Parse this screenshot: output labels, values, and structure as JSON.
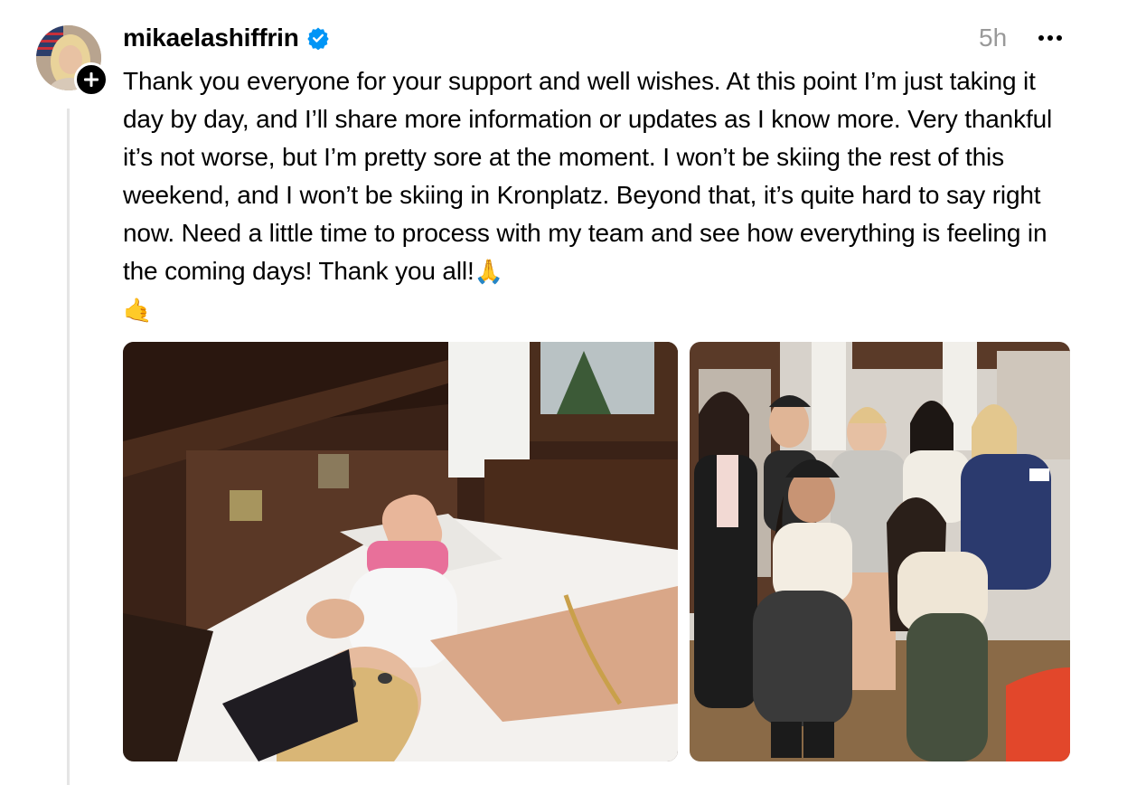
{
  "post": {
    "username": "mikaelashiffrin",
    "verified": true,
    "timestamp": "5h",
    "text_main": "Thank you everyone for your support and well wishes. At this point I’m just taking it day by day, and I’ll share more information or updates as I know more. Very thankful it’s not worse, but I’m pretty sore at the moment. I won’t be skiing the rest of this weekend, and I won’t be skiing in Kronplatz. Beyond that, it’s quite hard to say right now. Need a little time to process with my team and see how everything is feeling in the coming days! Thank you all!",
    "emoji_pray": "🙏",
    "emoji_call": "🤙"
  },
  "icons": {
    "avatar": "profile-photo",
    "follow": "plus-icon",
    "verified": "verified-badge-icon",
    "more": "more-options-icon"
  },
  "colors": {
    "verified_blue": "#0095f6",
    "timestamp_gray": "#999999",
    "thread_line": "#e5e5e5"
  },
  "media": [
    {
      "kind": "photo",
      "subject": "selfie-lying-on-bed"
    },
    {
      "kind": "photo",
      "subject": "group-photo-seven-women"
    }
  ]
}
